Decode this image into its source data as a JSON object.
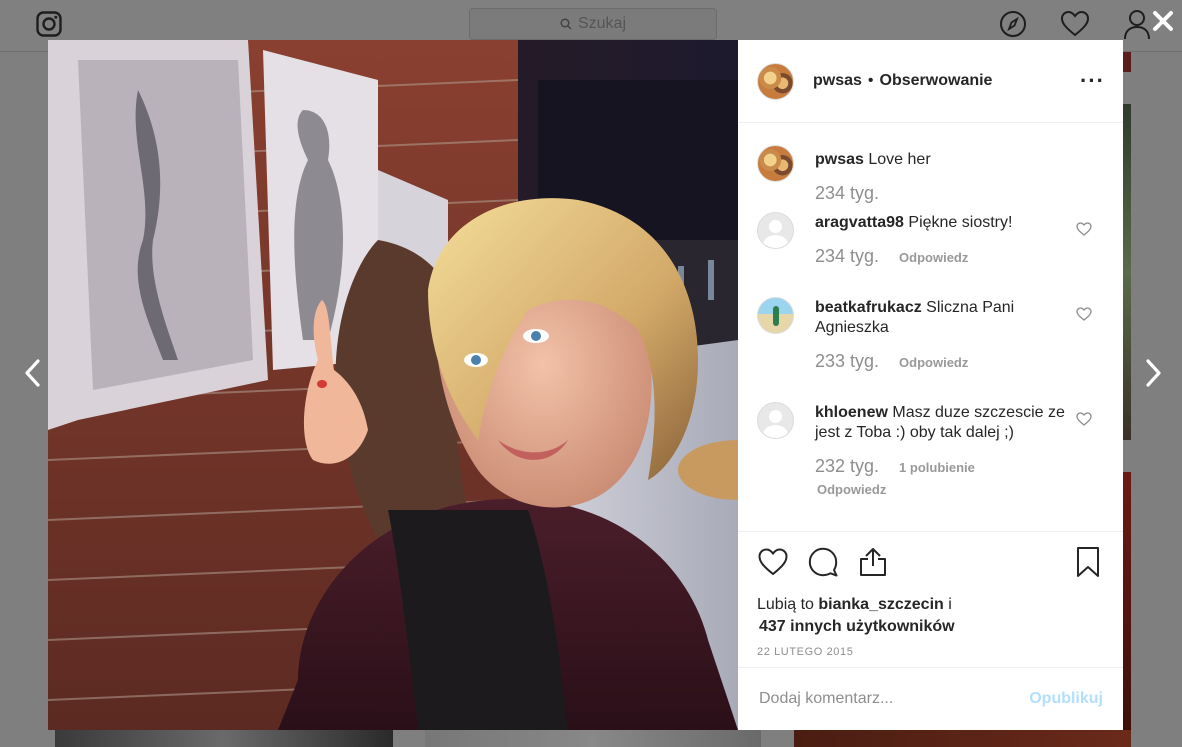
{
  "topbar": {
    "search_placeholder": "Szukaj",
    "icons": [
      "instagram-icon",
      "search-icon",
      "explore-icon",
      "heart-icon",
      "profile-icon"
    ]
  },
  "post": {
    "username": "pwsas",
    "separator": "•",
    "follow_status": "Obserwowanie",
    "comments": [
      {
        "user": "pwsas",
        "text": "Love her",
        "time": "234 tyg.",
        "likes": "",
        "reply": ""
      },
      {
        "user": "aragvatta98",
        "text": "Piękne siostry!",
        "time": "234 tyg.",
        "likes": "",
        "reply": "Odpowiedz"
      },
      {
        "user": "beatkafrukacz",
        "text": "Sliczna Pani Agnieszka",
        "time": "233 tyg.",
        "likes": "",
        "reply": "Odpowiedz"
      },
      {
        "user": "khloenew",
        "text": "Masz duze szczescie ze jest z Toba :) oby tak dalej ;)",
        "time": "232 tyg.",
        "likes": "1 polubienie",
        "reply": "Odpowiedz"
      }
    ],
    "likes_prefix": "Lubią to",
    "likes_user": "bianka_szczecin",
    "likes_conj": "i",
    "likes_others": "437 innych użytkowników",
    "date": "22 LUTEGO 2015",
    "comment_placeholder": "Dodaj komentarz...",
    "publish_label": "Opublikuj"
  },
  "colors": {
    "accent_disabled": "#b2dffc",
    "secondary_text": "#8e8e8e",
    "overlay": "#7f7f7f"
  }
}
